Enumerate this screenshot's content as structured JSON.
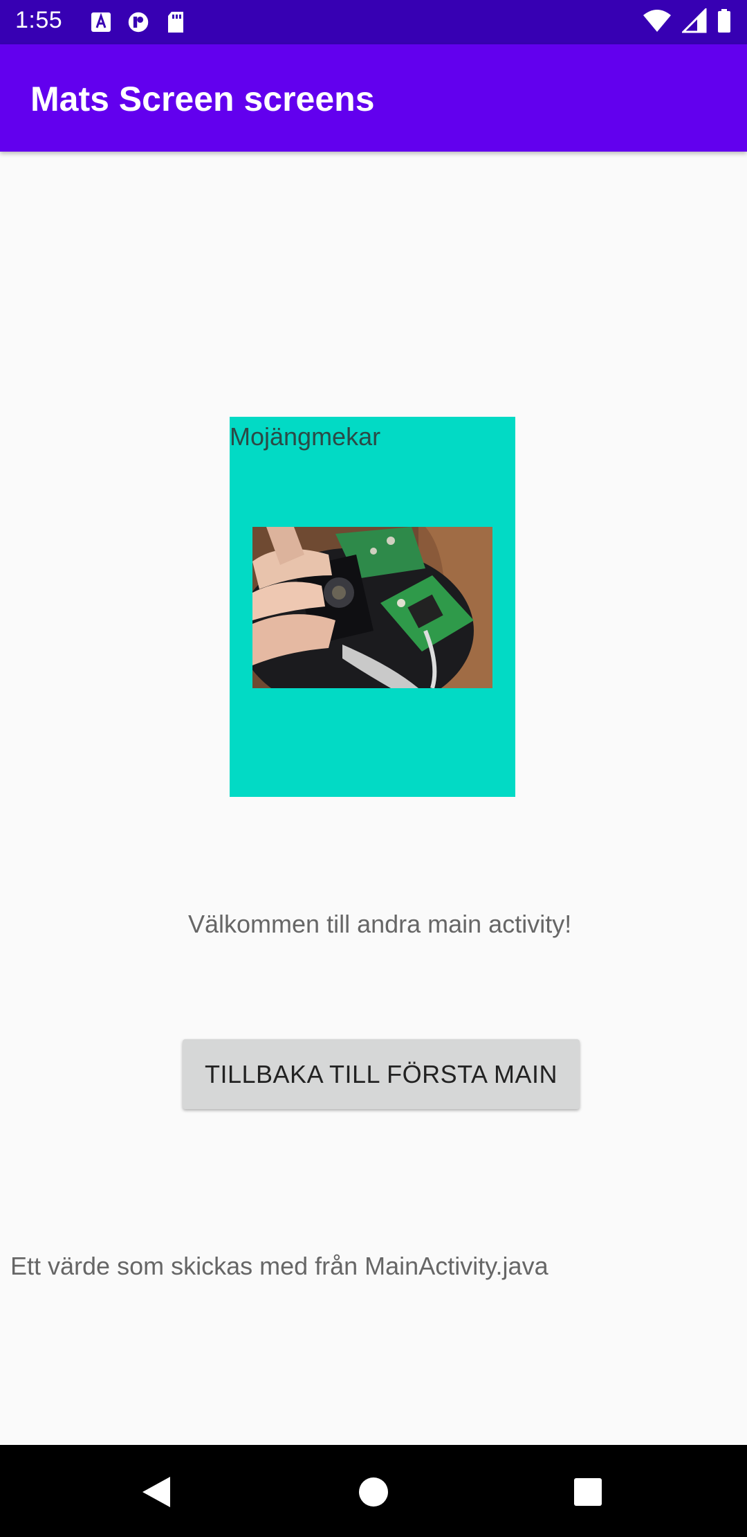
{
  "status_bar": {
    "time": "1:55",
    "left_icons": [
      "a-box-icon",
      "p-circle-icon",
      "sd-card-icon"
    ],
    "right_icons": [
      "wifi-icon",
      "signal-icon",
      "battery-icon"
    ]
  },
  "app_bar": {
    "title": "Mats Screen screens",
    "color": "#6200ee"
  },
  "card": {
    "label": "Mojängmekar",
    "background": "#02dac5",
    "image": "circuit-board-photo"
  },
  "welcome_text": "Välkommen till andra main activity!",
  "back_button": {
    "label": "TILLBAKA TILL FÖRSTA MAIN"
  },
  "value_text": "Ett värde som skickas med från MainActivity.java",
  "nav_bar": {
    "buttons": [
      "back-triangle-icon",
      "home-circle-icon",
      "recents-square-icon"
    ]
  }
}
